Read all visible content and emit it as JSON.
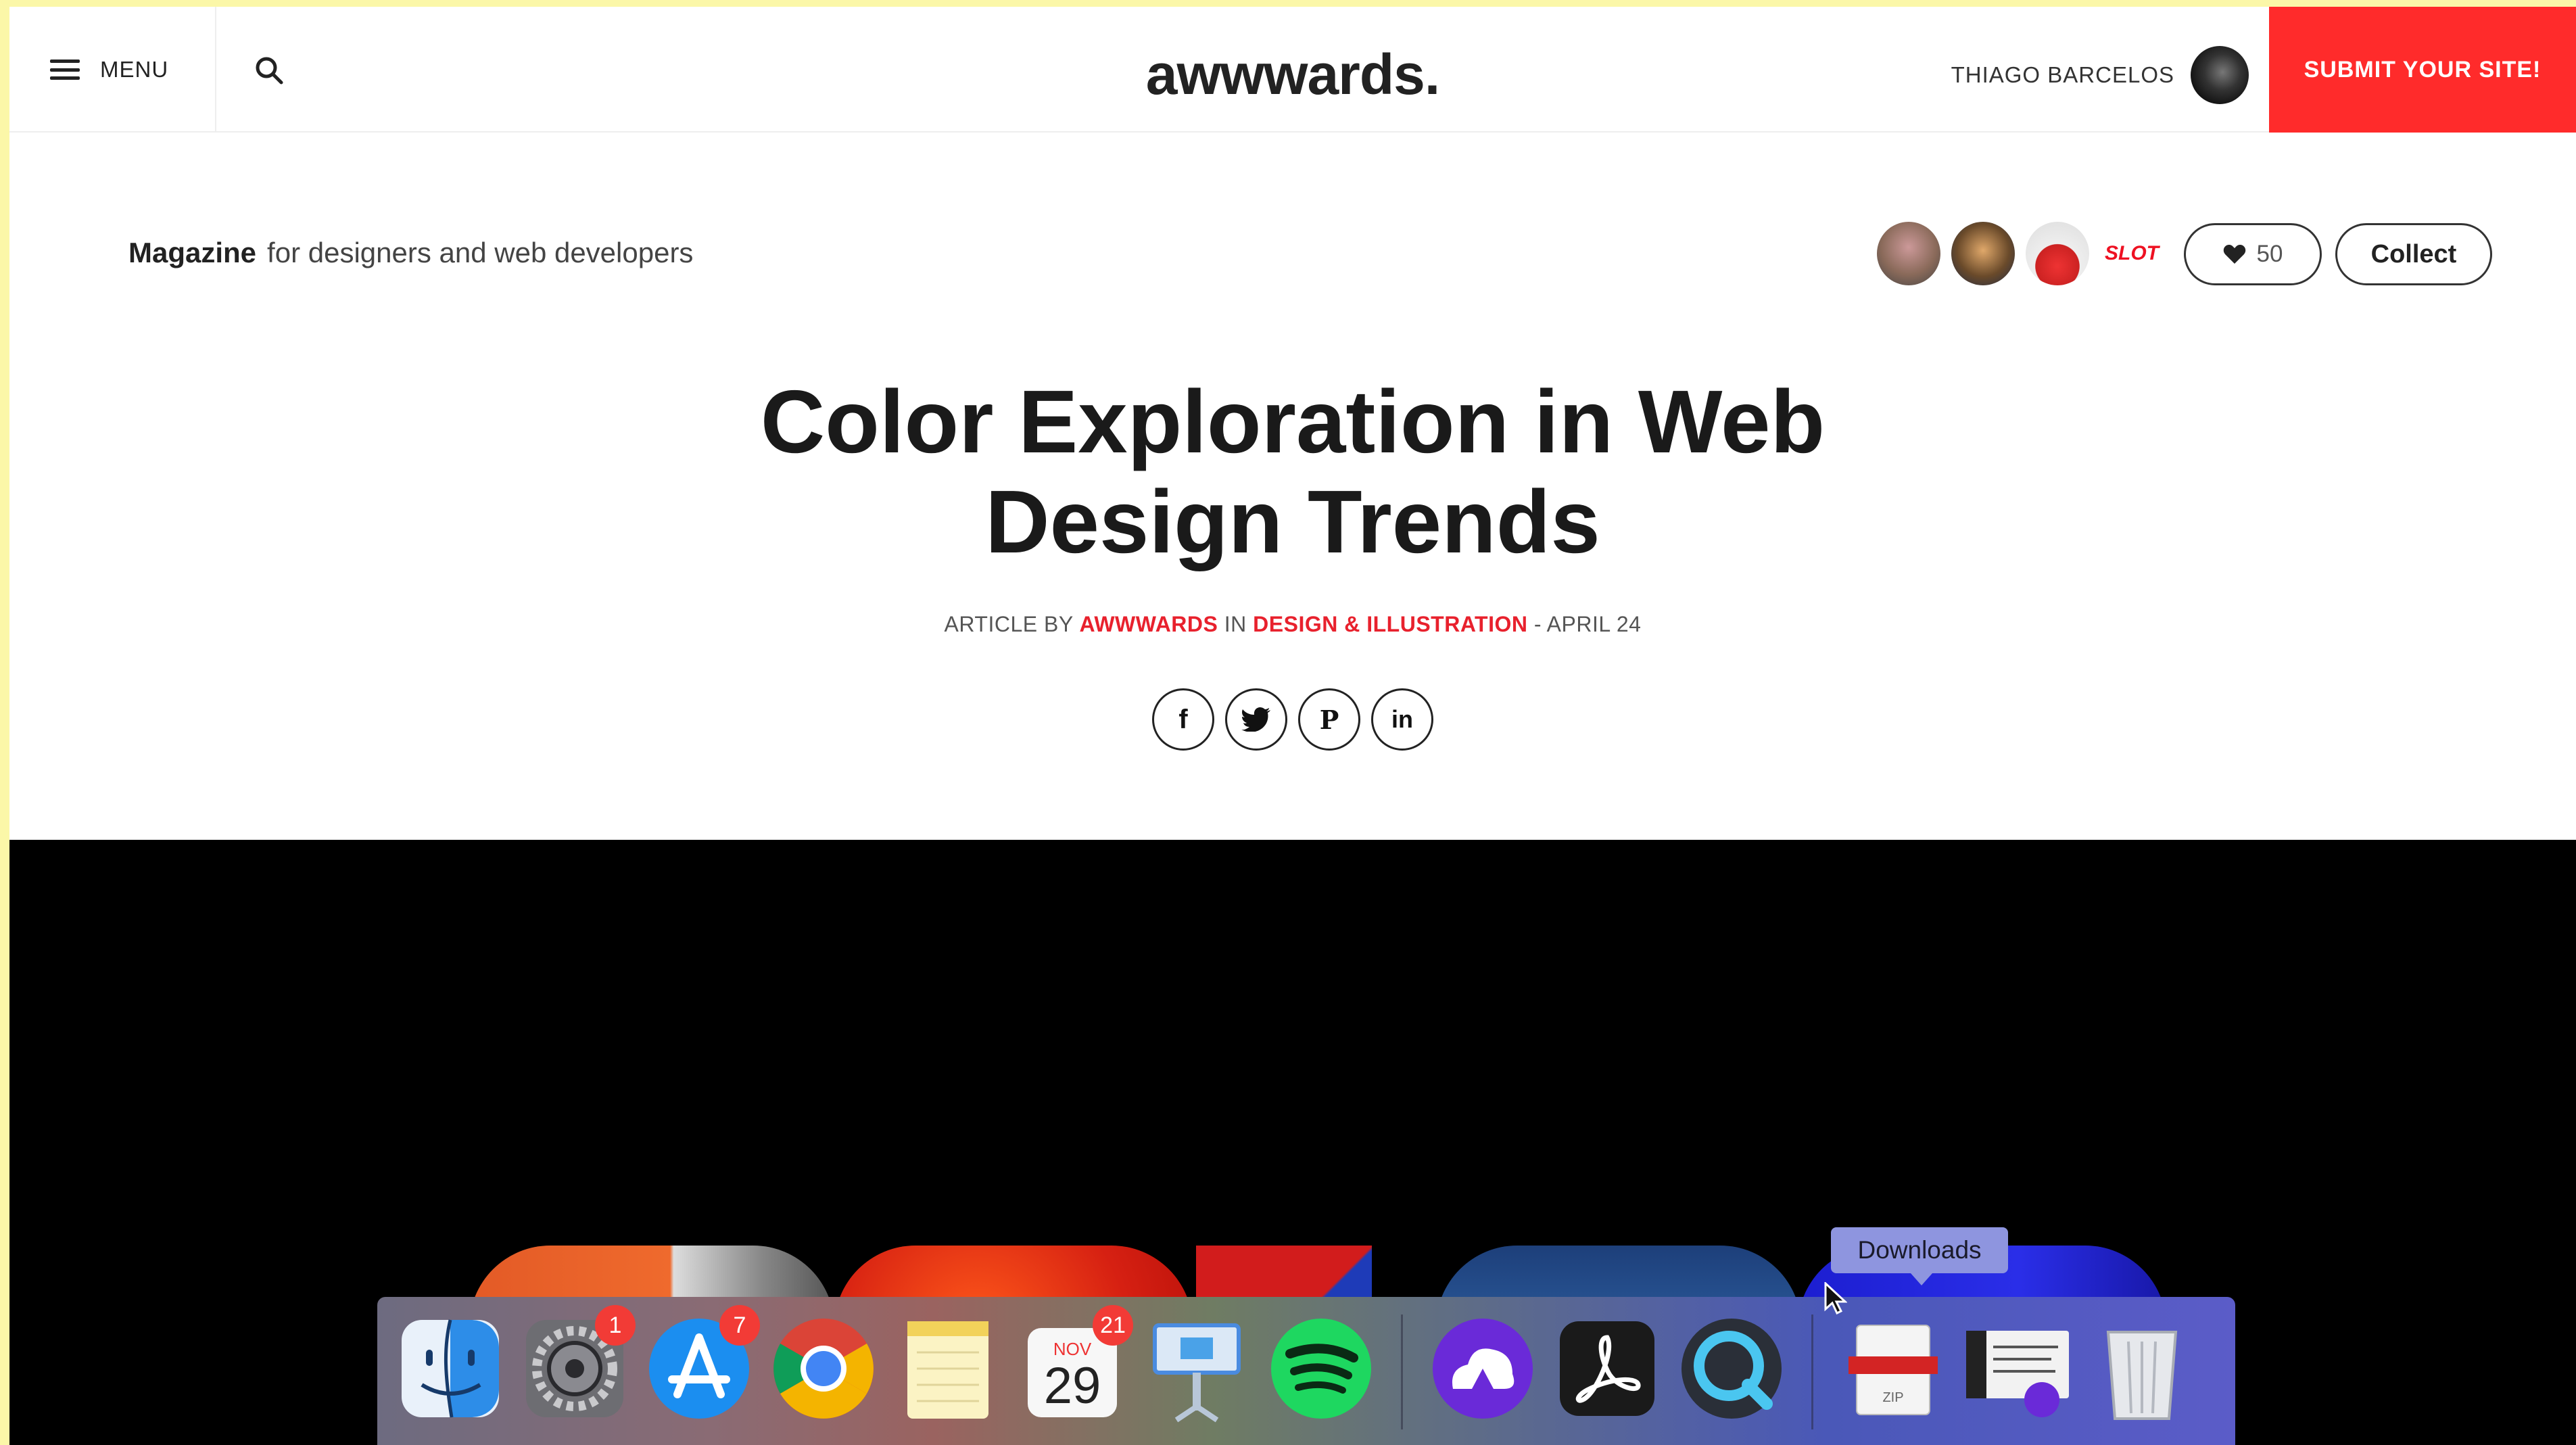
{
  "nav": {
    "menu_label": "MENU",
    "logo": "awwwards.",
    "user_name": "THIAGO BARCELOS",
    "submit_label": "SUBMIT YOUR SITE!"
  },
  "subheader": {
    "magazine": "Magazine",
    "tagline": "for designers and web developers",
    "sponsor_badge": "SLOT",
    "likes": "50",
    "collect_label": "Collect"
  },
  "article": {
    "title_line1": "Color Exploration in Web",
    "title_line2": "Design Trends",
    "byline_prefix": "ARTICLE BY",
    "author": "AWWWARDS",
    "in": "IN",
    "category": "DESIGN & ILLUSTRATION",
    "date": "- APRIL 24"
  },
  "share": [
    {
      "icon": "facebook-icon",
      "glyph": "f"
    },
    {
      "icon": "twitter-icon"
    },
    {
      "icon": "pinterest-icon",
      "glyph": "P"
    },
    {
      "icon": "linkedin-icon",
      "glyph": "in"
    }
  ],
  "dock": {
    "tooltip": "Downloads",
    "system_prefs_badge": "1",
    "app_store_badge": "7",
    "calendar_month": "NOV",
    "calendar_day": "29",
    "calendar_badge": "21",
    "zip_label": "ZIP"
  },
  "colors": {
    "accent_red": "#ff2b2b",
    "link_red": "#e8212d",
    "frame_yellow": "#fbf7a8"
  }
}
